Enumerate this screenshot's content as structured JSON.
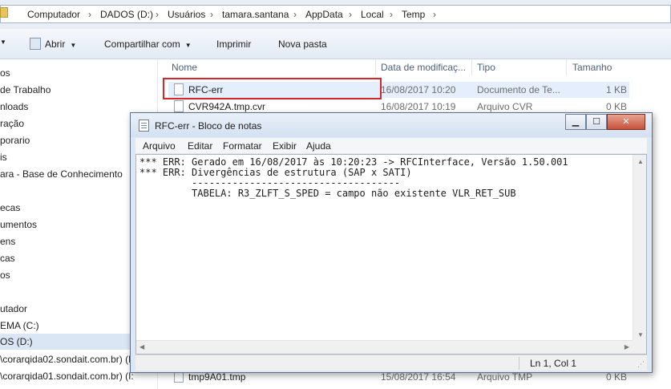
{
  "address": {
    "crumbs": [
      "Computador",
      "DADOS (D:)",
      "Usuários",
      "tamara.santana",
      "AppData",
      "Local",
      "Temp"
    ]
  },
  "toolbar": {
    "open_label": "Abrir",
    "share_label": "Compartilhar com",
    "print_label": "Imprimir",
    "new_folder_label": "Nova pasta"
  },
  "nav": {
    "items": [
      "os",
      "de Trabalho",
      "nloads",
      "ração",
      "porario",
      "is",
      "ara - Base de Conhecimento",
      "",
      "ecas",
      "umentos",
      "ens",
      "cas",
      "os",
      "",
      "utador",
      "EMA (C:)",
      "OS (D:)",
      "\\corarqida02.sondait.com.br) (L",
      "\\corarqida01.sondait.com.br) (I:"
    ]
  },
  "columns": {
    "name": "Nome",
    "date": "Data de modificaç...",
    "type": "Tipo",
    "size": "Tamanho"
  },
  "files": [
    {
      "name": "RFC-err",
      "date": "16/08/2017 10:20",
      "type": "Documento de Te...",
      "size": "1 KB"
    },
    {
      "name": "CVR942A.tmp.cvr",
      "date": "16/08/2017 10:19",
      "type": "Arquivo CVR",
      "size": "0 KB"
    },
    {
      "name": "tmp9A01.tmp",
      "date": "15/08/2017 16:54",
      "type": "Arquivo TMP",
      "size": "0 KB"
    }
  ],
  "notepad": {
    "title": "RFC-err - Bloco de notas",
    "menu": [
      "Arquivo",
      "Editar",
      "Formatar",
      "Exibir",
      "Ajuda"
    ],
    "lines": [
      "*** ERR: Gerado em 16/08/2017 às 10:20:23 -> RFCInterface, Versão 1.50.001",
      "*** ERR: Divergências de estrutura (SAP x SATI)",
      "         ------------------------------------",
      "         TABELA: R3_ZLFT_S_SPED = campo não existente VLR_RET_SUB"
    ],
    "status": "Ln 1, Col 1"
  }
}
